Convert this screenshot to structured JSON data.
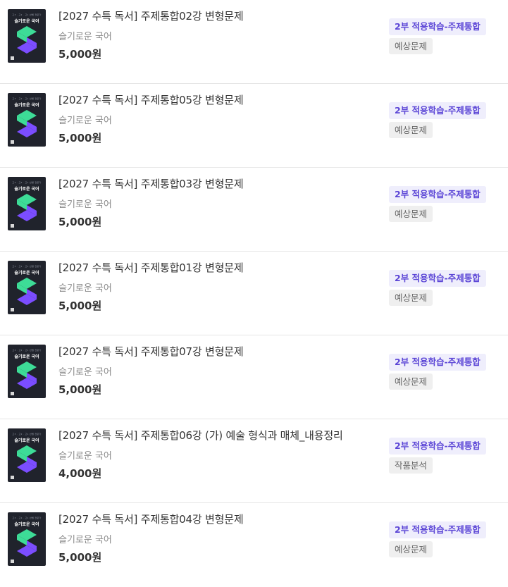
{
  "thumbnail": {
    "top_text": "고3 · 고2 · 고1 반별 전문가",
    "title": "슬기로운 국어"
  },
  "items": [
    {
      "title": "[2027 수특 독서] 주제통합02강 변형문제",
      "author": "슬기로운 국어",
      "price": "5,000원",
      "category": "2부 적용학습-주제통합",
      "type": "예상문제"
    },
    {
      "title": "[2027 수특 독서] 주제통합05강 변형문제",
      "author": "슬기로운 국어",
      "price": "5,000원",
      "category": "2부 적용학습-주제통합",
      "type": "예상문제"
    },
    {
      "title": "[2027 수특 독서] 주제통합03강 변형문제",
      "author": "슬기로운 국어",
      "price": "5,000원",
      "category": "2부 적용학습-주제통합",
      "type": "예상문제"
    },
    {
      "title": "[2027 수특 독서] 주제통합01강 변형문제",
      "author": "슬기로운 국어",
      "price": "5,000원",
      "category": "2부 적용학습-주제통합",
      "type": "예상문제"
    },
    {
      "title": "[2027 수특 독서] 주제통합07강 변형문제",
      "author": "슬기로운 국어",
      "price": "5,000원",
      "category": "2부 적용학습-주제통합",
      "type": "예상문제"
    },
    {
      "title": "[2027 수특 독서] 주제통합06강 (가) 예술 형식과 매체_내용정리",
      "author": "슬기로운 국어",
      "price": "4,000원",
      "category": "2부 적용학습-주제통합",
      "type": "작품분석"
    },
    {
      "title": "[2027 수특 독서] 주제통합04강 변형문제",
      "author": "슬기로운 국어",
      "price": "5,000원",
      "category": "2부 적용학습-주제통합",
      "type": "예상문제"
    }
  ],
  "colors": {
    "logo_green": "#3ddc97",
    "logo_purple": "#7b4dff",
    "badge_accent": "#5b45d6",
    "thumb_bg": "#20232c"
  }
}
